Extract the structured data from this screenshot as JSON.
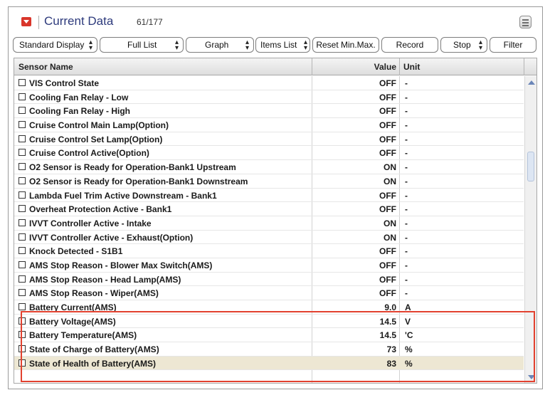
{
  "header": {
    "title": "Current Data",
    "count": "61/177"
  },
  "toolbar": {
    "standard_display": "Standard Display",
    "full_list": "Full List",
    "graph": "Graph",
    "items_list": "Items List",
    "reset": "Reset Min.Max.",
    "record": "Record",
    "stop": "Stop",
    "filter": "Filter"
  },
  "table": {
    "columns": {
      "name": "Sensor Name",
      "value": "Value",
      "unit": "Unit"
    },
    "rows": [
      {
        "name": "VIS Control State",
        "value": "OFF",
        "unit": "-"
      },
      {
        "name": "Cooling Fan Relay - Low",
        "value": "OFF",
        "unit": "-"
      },
      {
        "name": "Cooling Fan Relay - High",
        "value": "OFF",
        "unit": "-"
      },
      {
        "name": "Cruise Control Main Lamp(Option)",
        "value": "OFF",
        "unit": "-"
      },
      {
        "name": "Cruise Control Set Lamp(Option)",
        "value": "OFF",
        "unit": "-"
      },
      {
        "name": "Cruise Control Active(Option)",
        "value": "OFF",
        "unit": "-"
      },
      {
        "name": "O2 Sensor is Ready for Operation-Bank1 Upstream",
        "value": "ON",
        "unit": "-"
      },
      {
        "name": "O2 Sensor is Ready for Operation-Bank1 Downstream",
        "value": "ON",
        "unit": "-"
      },
      {
        "name": "Lambda Fuel Trim Active Downstream - Bank1",
        "value": "OFF",
        "unit": "-"
      },
      {
        "name": "Overheat Protection Active - Bank1",
        "value": "OFF",
        "unit": "-"
      },
      {
        "name": "IVVT Controller Active - Intake",
        "value": "ON",
        "unit": "-"
      },
      {
        "name": "IVVT Controller Active - Exhaust(Option)",
        "value": "ON",
        "unit": "-"
      },
      {
        "name": "Knock Detected - S1B1",
        "value": "OFF",
        "unit": "-"
      },
      {
        "name": "AMS Stop Reason - Blower Max Switch(AMS)",
        "value": "OFF",
        "unit": "-"
      },
      {
        "name": "AMS Stop Reason - Head Lamp(AMS)",
        "value": "OFF",
        "unit": "-"
      },
      {
        "name": "AMS Stop Reason - Wiper(AMS)",
        "value": "OFF",
        "unit": "-"
      },
      {
        "name": "Battery Current(AMS)",
        "value": "9.0",
        "unit": "A"
      },
      {
        "name": "Battery Voltage(AMS)",
        "value": "14.5",
        "unit": "V"
      },
      {
        "name": "Battery Temperature(AMS)",
        "value": "14.5",
        "unit": "'C"
      },
      {
        "name": "State of Charge of Battery(AMS)",
        "value": "73",
        "unit": "%"
      },
      {
        "name": "State of Health of Battery(AMS)",
        "value": "83",
        "unit": "%"
      }
    ]
  },
  "colors": {
    "accent": "#d9362b",
    "title": "#2d3a7c",
    "highlight_border": "#e2412f",
    "selected_row": "#ede7d3"
  },
  "icons": {
    "title_icon": "chevron-down-icon",
    "menu_icon": "menu-icon",
    "checkbox": "checkbox-icon"
  }
}
